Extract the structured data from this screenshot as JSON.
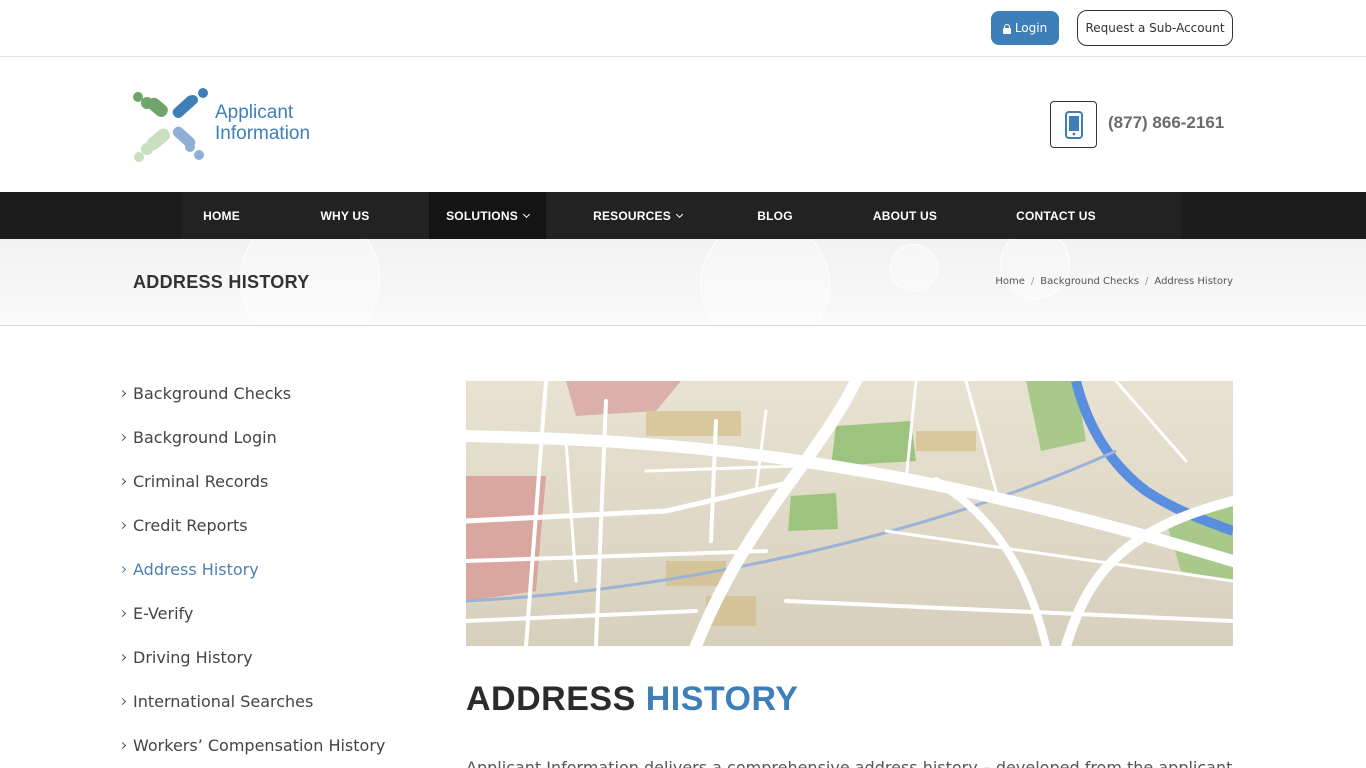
{
  "topbar": {
    "login_label": "Login",
    "subaccount_label": "Request a Sub-Account"
  },
  "header": {
    "logo_line1": "Applicant",
    "logo_line2": "Information",
    "phone": "(877) 866-2161"
  },
  "nav": {
    "items": [
      {
        "label": "HOME"
      },
      {
        "label": "WHY US"
      },
      {
        "label": "SOLUTIONS"
      },
      {
        "label": "RESOURCES"
      },
      {
        "label": "BLOG"
      },
      {
        "label": "ABOUT US"
      },
      {
        "label": "CONTACT US"
      }
    ]
  },
  "titlebar": {
    "title": "ADDRESS HISTORY",
    "breadcrumb": [
      "Home",
      "Background Checks",
      "Address History"
    ],
    "separator": "/"
  },
  "sidebar": {
    "items": [
      {
        "label": "Background Checks"
      },
      {
        "label": "Background Login"
      },
      {
        "label": "Criminal Records"
      },
      {
        "label": "Credit Reports"
      },
      {
        "label": "Address History"
      },
      {
        "label": "E-Verify"
      },
      {
        "label": "Driving History"
      },
      {
        "label": "International Searches"
      },
      {
        "label": "Workers’ Compensation History"
      }
    ],
    "active_label": "Address History"
  },
  "content": {
    "heading_part1": "ADDRESS",
    "heading_part2": "HISTORY",
    "paragraph": "Applicant Information delivers a comprehensive address history – developed from the applicant's"
  },
  "colors": {
    "accent": "#3f7fb9",
    "nav_bg": "#1c1c1c",
    "sidebar_active": "#4f7fae"
  }
}
